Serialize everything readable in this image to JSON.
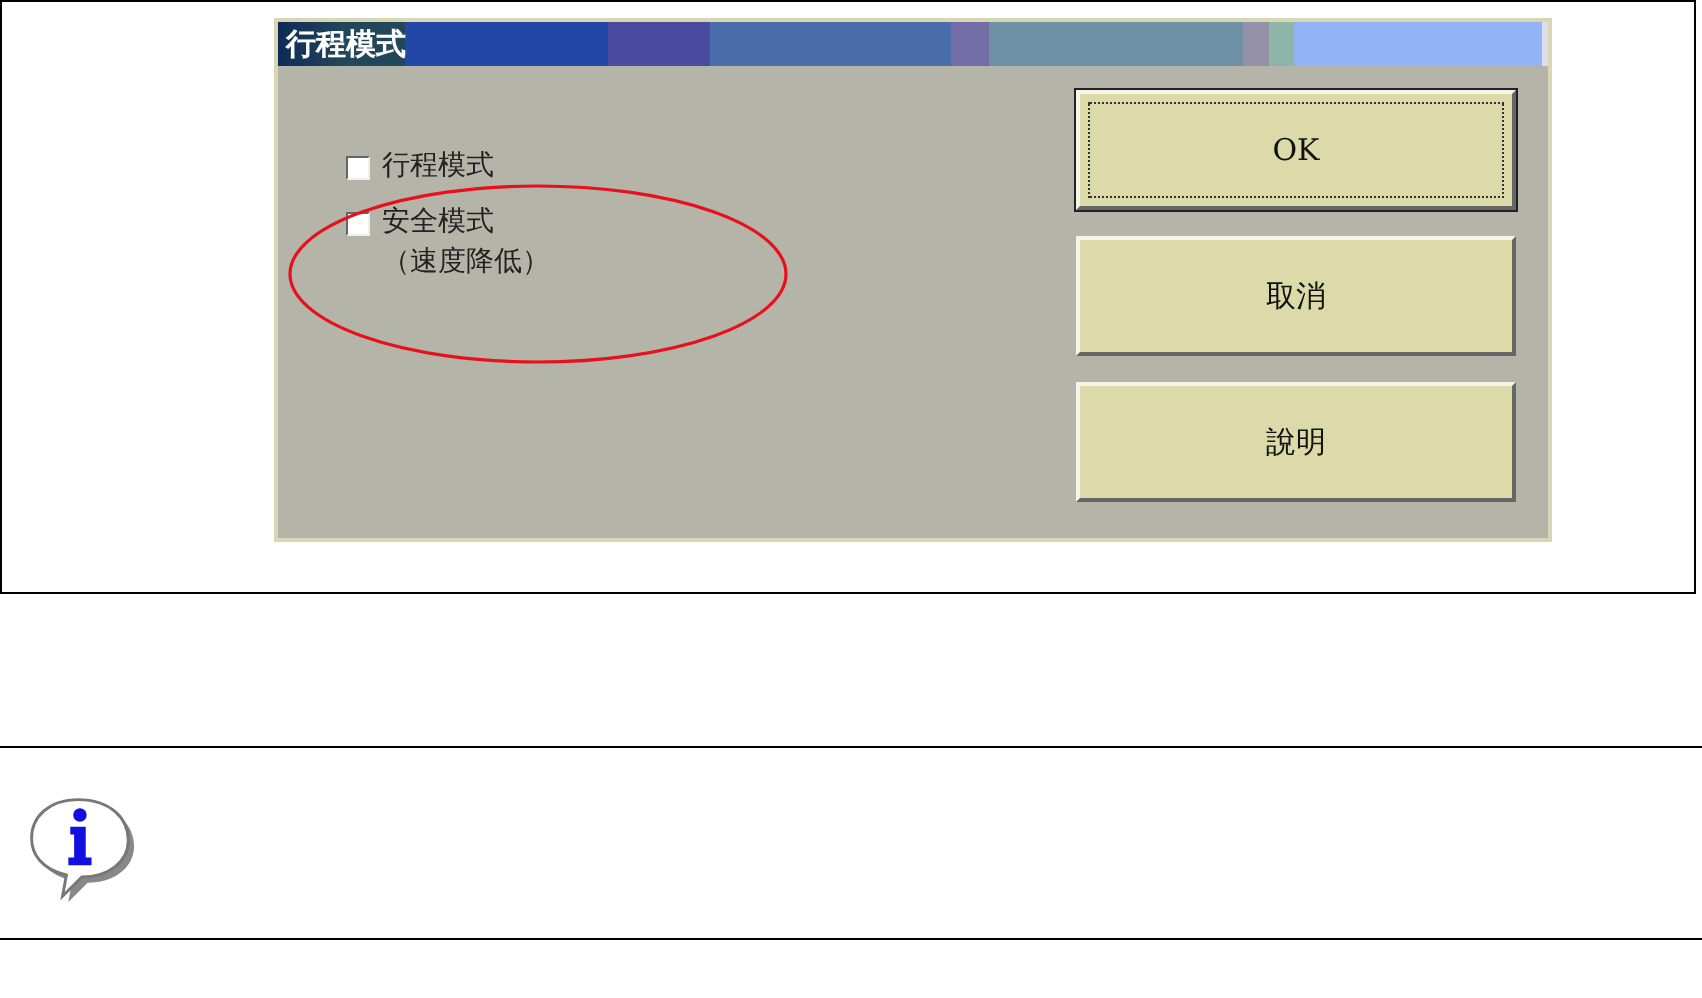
{
  "dialog": {
    "title": "行程模式",
    "checkboxes": [
      {
        "label": "行程模式",
        "checked": false,
        "circled": false
      },
      {
        "label": "安全模式",
        "note": "（速度降低）",
        "checked": false,
        "circled": true
      }
    ],
    "buttons": [
      {
        "label": "OK",
        "focused": true
      },
      {
        "label": "取消",
        "focused": false
      },
      {
        "label": "說明",
        "focused": false
      }
    ]
  },
  "note_box": {
    "kind": "info"
  }
}
